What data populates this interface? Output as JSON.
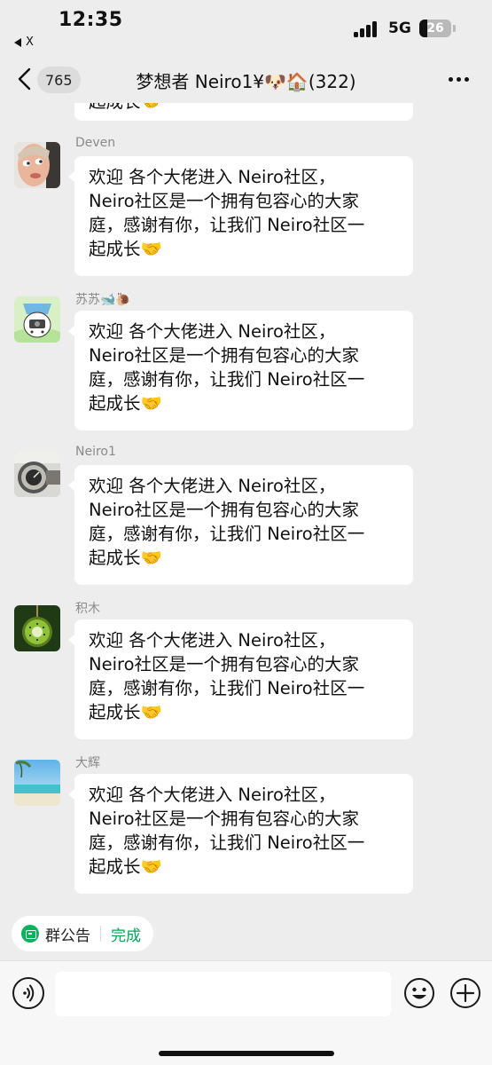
{
  "status_bar": {
    "time": "12:35",
    "back_app": "X",
    "network": "5G",
    "battery": "26"
  },
  "nav": {
    "unread_count": "765",
    "title": "梦想者 Neiro1¥🐶🏠(322)"
  },
  "messages": [
    {
      "sender": "Deven",
      "avatar_icon": "avatar-face-photo",
      "lines": [
        "欢迎 各个大佬进入 Neiro社区，",
        "Neiro社区是一个拥有包容心的大家",
        "庭，感谢有你，让我们 Neiro社区一",
        "起成长🤝"
      ]
    },
    {
      "sender": "苏苏🐋🐌",
      "avatar_icon": "avatar-cartoon-cat",
      "lines": [
        "欢迎 各个大佬进入 Neiro社区，",
        "Neiro社区是一个拥有包容心的大家",
        "庭，感谢有你，让我们 Neiro社区一",
        "起成长🤝"
      ]
    },
    {
      "sender": "Neiro1",
      "avatar_icon": "avatar-watch-photo",
      "lines": [
        "欢迎 各个大佬进入 Neiro社区，",
        "Neiro社区是一个拥有包容心的大家",
        "庭，感谢有你，让我们 Neiro社区一",
        "起成长🤝"
      ]
    },
    {
      "sender": "积木",
      "avatar_icon": "avatar-kiwi-photo",
      "lines": [
        "欢迎 各个大佬进入 Neiro社区，",
        "Neiro社区是一个拥有包容心的大家",
        "庭，感谢有你，让我们 Neiro社区一",
        "起成长🤝"
      ]
    },
    {
      "sender": "大辉",
      "avatar_icon": "avatar-beach-photo",
      "lines": [
        "欢迎 各个大佬进入 Neiro社区，",
        "Neiro社区是一个拥有包容心的大家",
        "庭，感谢有你，让我们 Neiro社区一",
        "起成长🤝"
      ]
    }
  ],
  "partial_top_message": "起成长🤝",
  "notice": {
    "label": "群公告",
    "done": "完成"
  },
  "input": {
    "value": ""
  },
  "colors": {
    "background": "#ededed",
    "bubble": "#ffffff",
    "accent_green": "#07b35c"
  }
}
